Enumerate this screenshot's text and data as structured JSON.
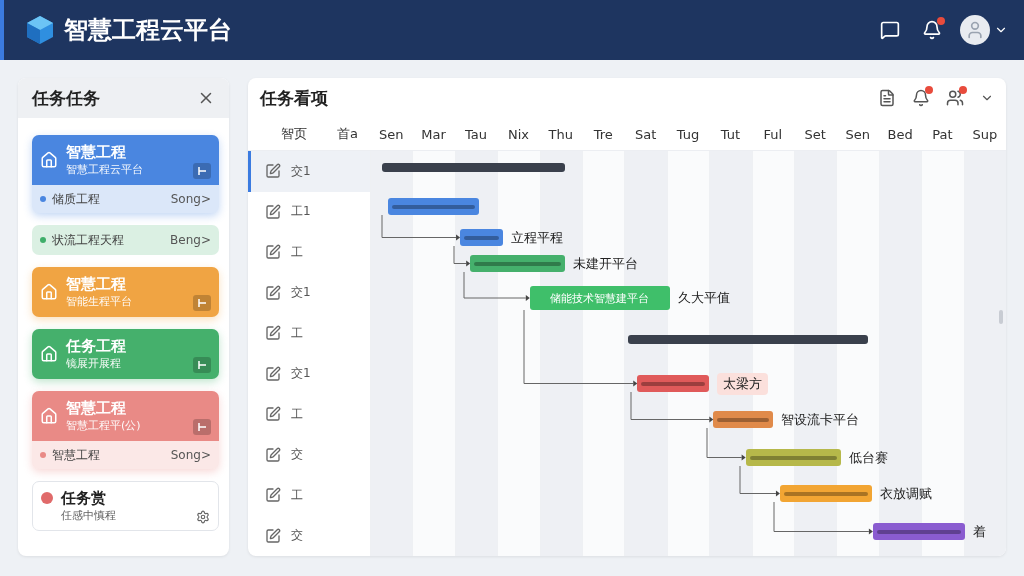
{
  "header": {
    "title": "智慧工程云平台",
    "notifications": true
  },
  "sidebar": {
    "title": "任务任务",
    "cards": [
      {
        "kind": "card",
        "color": "#4a86e0",
        "title": "智慧工程",
        "subtitle": "智慧工程云平台",
        "footer": {
          "text": "储质工程",
          "link": "Song>"
        }
      },
      {
        "kind": "strip",
        "color": "#3fae6a",
        "text": "状流工程天程",
        "link": "Beng>"
      },
      {
        "kind": "card",
        "color": "#f0a443",
        "title": "智慧工程",
        "subtitle": "智能生程平台"
      },
      {
        "kind": "card",
        "color": "#45b06c",
        "title": "任务工程",
        "subtitle": "镜展开展程"
      },
      {
        "kind": "card",
        "color": "#e98a86",
        "title": "智慧工程",
        "subtitle": "智慧工程平(公)",
        "footer": {
          "text": "智慧工程",
          "link": "Song>"
        }
      },
      {
        "kind": "plain",
        "color": "#e06a6a",
        "title": "任务赏",
        "subtitle": "任感中慎程"
      }
    ]
  },
  "gantt": {
    "title": "任务看项",
    "alerts": true,
    "columns": [
      "智页",
      "首a"
    ],
    "days": [
      "Sen",
      "Mar",
      "Tau",
      "Nix",
      "Thu",
      "Tre",
      "Sat",
      "Tug",
      "Tut",
      "Ful",
      "Set",
      "Sen",
      "Bed",
      "Pat",
      "Sup"
    ],
    "rows": [
      {
        "label": "交1",
        "selected": true
      },
      {
        "label": "工1",
        "selected": false
      },
      {
        "label": "工",
        "selected": false
      },
      {
        "label": "交1",
        "selected": false
      },
      {
        "label": "工",
        "selected": false
      },
      {
        "label": "交1",
        "selected": false
      },
      {
        "label": "工",
        "selected": false
      },
      {
        "label": "交",
        "selected": false
      },
      {
        "label": "工",
        "selected": false
      },
      {
        "label": "交",
        "selected": false
      }
    ],
    "tasks": [
      {
        "kind": "bar",
        "color": "#4a86e0"
      },
      {
        "kind": "bar",
        "color": "#4a86e0",
        "label": "立程平程"
      },
      {
        "kind": "bar",
        "color": "#45b06c",
        "label": "未建开平台"
      },
      {
        "kind": "wide",
        "color": "#3fbf6a",
        "inner_text": "储能技术智慧建平台",
        "label": "久大平值"
      },
      {
        "kind": "chip",
        "color": "#e05a5a",
        "label": "太梁方"
      },
      {
        "kind": "bar",
        "color": "#e08a4a",
        "label": "智设流卡平台"
      },
      {
        "kind": "bar",
        "color": "#b6b84a",
        "label": "低台赛"
      },
      {
        "kind": "bar",
        "color": "#f2a533",
        "label": "衣放调赋"
      },
      {
        "kind": "bar",
        "color": "#8a5cd0",
        "label": "着"
      }
    ]
  }
}
